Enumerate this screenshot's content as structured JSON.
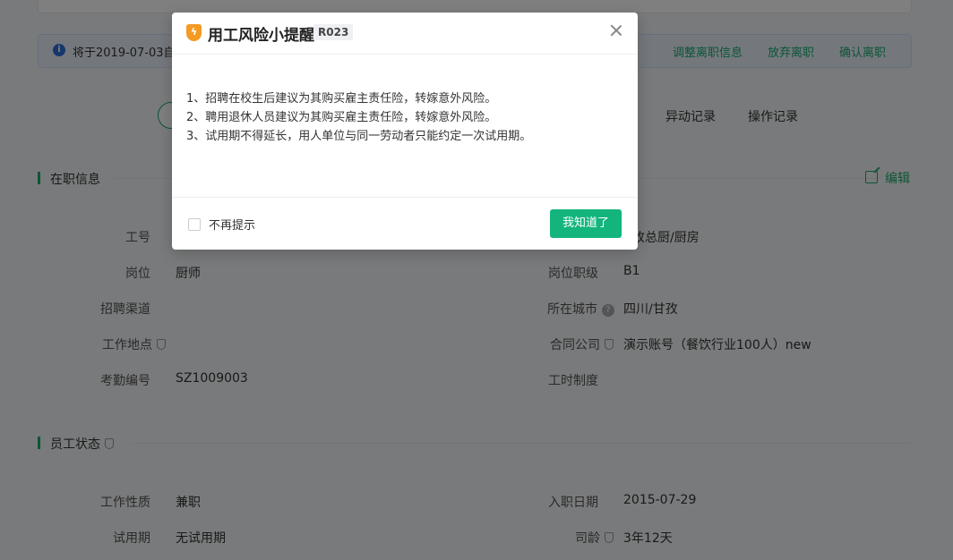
{
  "notice": {
    "text": "将于2019-07-03自",
    "actions": [
      "调整离职信息",
      "放弃离职",
      "确认离职"
    ]
  },
  "tabs": [
    "异动记录",
    "操作记录"
  ],
  "section_job": {
    "title": "在职信息",
    "edit_label": "编辑",
    "left": [
      {
        "label": "工号",
        "value": ""
      },
      {
        "label": "岗位",
        "value": "厨师"
      },
      {
        "label": "招聘渠道",
        "value": ""
      },
      {
        "label": "工作地点",
        "value": ""
      },
      {
        "label": "考勤编号",
        "value": "SZ1009003"
      }
    ],
    "right": [
      {
        "label": "",
        "value": "孜总厨/厨房"
      },
      {
        "label": "岗位职级",
        "value": "B1"
      },
      {
        "label": "所在城市",
        "value": "四川/甘孜"
      },
      {
        "label": "合同公司",
        "value": "演示账号（餐饮行业100人）new"
      },
      {
        "label": "工时制度",
        "value": ""
      }
    ]
  },
  "section_status": {
    "title": "员工状态",
    "left": [
      {
        "label": "工作性质",
        "value": "兼职"
      },
      {
        "label": "试用期",
        "value": "无试用期"
      }
    ],
    "right": [
      {
        "label": "入职日期",
        "value": "2015-07-29"
      },
      {
        "label": "司龄",
        "value": "3年12天"
      }
    ]
  },
  "modal": {
    "title": "用工风险小提醒",
    "code": "R023",
    "lines": [
      "1、招聘在校生后建议为其购买雇主责任险，转嫁意外风险。",
      "2、聘用退休人员建议为其购买雇主责任险，转嫁意外风险。",
      "3、试用期不得延长，用人单位与同一劳动者只能约定一次试用期。"
    ],
    "checkbox_label": "不再提示",
    "ok_label": "我知道了"
  }
}
